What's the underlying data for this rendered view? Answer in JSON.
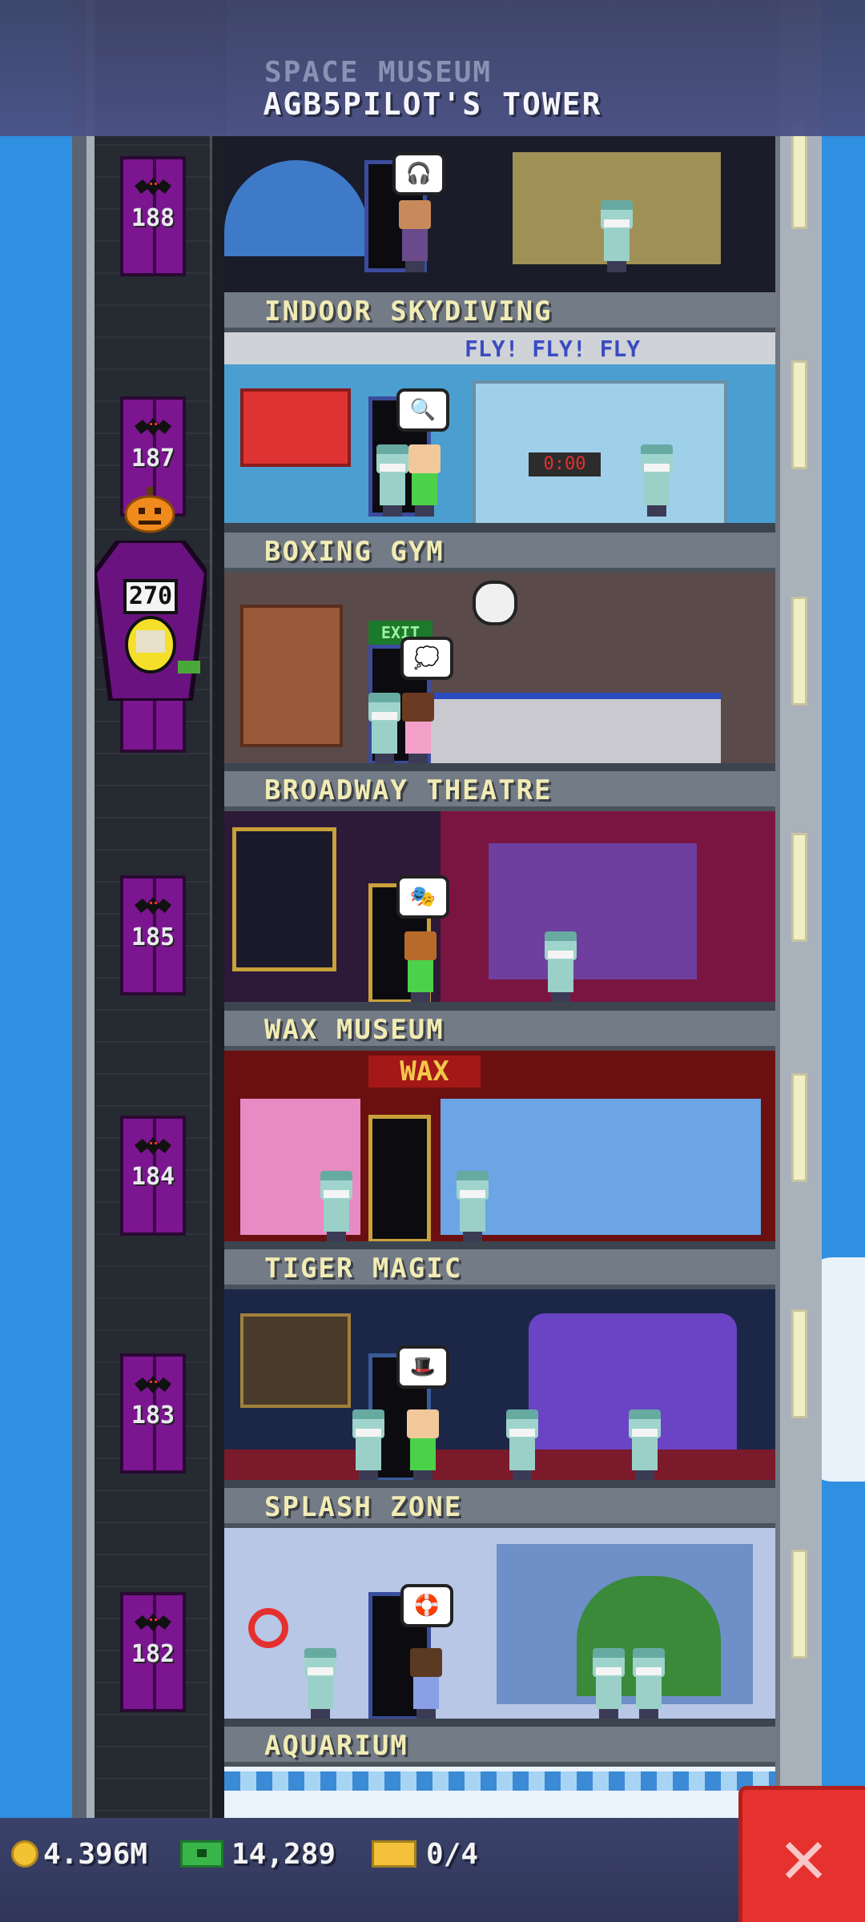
{
  "header": {
    "faded_floor_label": "SPACE MUSEUM",
    "tower_title": "AGB5PILOT'S TOWER"
  },
  "elevator": {
    "floor_numbers": [
      "188",
      "187",
      "185",
      "184",
      "183",
      "182"
    ],
    "car_number": "270"
  },
  "floors": [
    {
      "name": "INDOOR SKYDIVING",
      "sign": "FLY! FLY! FLY"
    },
    {
      "name": "BOXING GYM",
      "sign": "EXIT"
    },
    {
      "name": "BROADWAY THEATRE"
    },
    {
      "name": "WAX MUSEUM",
      "sign": "WAX"
    },
    {
      "name": "TIGER MAGIC"
    },
    {
      "name": "SPLASH ZONE"
    },
    {
      "name": "AQUARIUM"
    }
  ],
  "status_bar": {
    "coins": "4.396M",
    "bux": "14,289",
    "tickets": "0/4"
  },
  "colors": {
    "sky": "#2f8fe0",
    "elevator_door": "#7b1690",
    "label_text": "#f1ecb5",
    "close_button": "#e5322f"
  },
  "icons": [
    "coin-icon",
    "bux-icon",
    "ticket-icon",
    "close-icon",
    "bat-icon",
    "pumpkin-icon"
  ]
}
